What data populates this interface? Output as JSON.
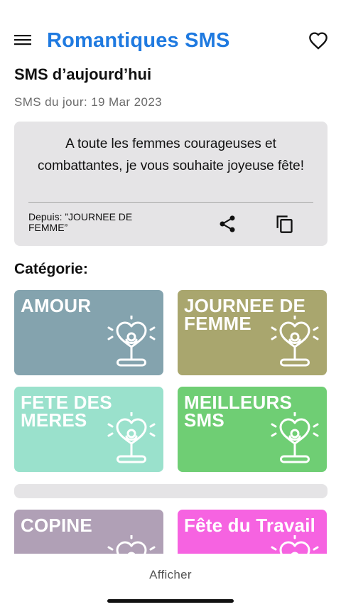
{
  "app": {
    "title": "Romantiques SMS",
    "brand_color": "#1f7ae0",
    "menu_icon": "hamburger-menu-icon",
    "favorite_icon": "heart-outline-icon"
  },
  "daily": {
    "section_title": "SMS d’aujourd’hui",
    "date_text": "SMS du jour: 19 Mar 2023",
    "message": "A toute les femmes courageuses et combattantes, je vous souhaite joyeuse fête!",
    "source": "Depuis: ”JOURNEE DE FEMME”",
    "share_icon": "share-icon",
    "copy_icon": "copy-icon"
  },
  "categories": {
    "title": "Catégorie:",
    "items": [
      {
        "label": "AMOUR",
        "color": "#84a3ae"
      },
      {
        "label": "JOURNEE DE FEMME",
        "color": "#a9a66e"
      },
      {
        "label": "FETE DES MERES",
        "color": "#9ae1cc"
      },
      {
        "label": "MEILLEURS SMS",
        "color": "#6fce74"
      },
      {
        "label": "COPINE",
        "color": "#b0a0b6"
      },
      {
        "label": "Fête du Travail",
        "color": "#f663e1"
      }
    ]
  },
  "bottom": {
    "show_label": "Afficher"
  }
}
